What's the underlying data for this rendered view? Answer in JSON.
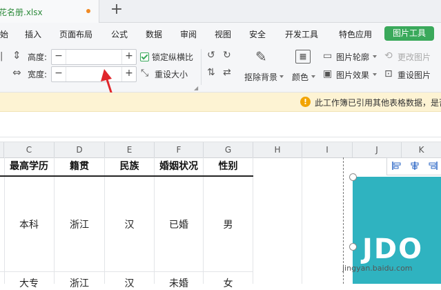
{
  "tabs": {
    "file_name": "花名册.xlsx",
    "add_tab": "+"
  },
  "menu": {
    "items": [
      "始",
      "插入",
      "页面布局",
      "公式",
      "数据",
      "审阅",
      "视图",
      "安全",
      "开发工具",
      "特色应用"
    ],
    "active": "图片工具"
  },
  "toolbar": {
    "height_label": "高度:",
    "width_label": "宽度:",
    "height_value": "",
    "width_value": "",
    "minus": "−",
    "plus": "+",
    "lock_ratio": "锁定纵横比",
    "lock_ratio_checked": true,
    "reset_size": "重设大小",
    "remove_bg": "抠除背景",
    "color": "颜色",
    "outline": "图片轮廓",
    "effects": "图片效果",
    "change_picture": "更改图片",
    "reset_picture": "重设图片"
  },
  "notice": {
    "icon": "!",
    "message": "此工作簿已引用其他表格数据，是否"
  },
  "grid": {
    "columns": [
      "C",
      "D",
      "E",
      "F",
      "G",
      "H",
      "I",
      "J",
      "K"
    ],
    "headers": [
      "最高学历",
      "籍贯",
      "民族",
      "婚姻状况",
      "性别"
    ],
    "rows": [
      [
        "本科",
        "浙江",
        "汉",
        "已婚",
        "男"
      ],
      [
        "大专",
        "浙江",
        "汉",
        "未婚",
        "女"
      ]
    ]
  },
  "picture": {
    "text": "JDO",
    "watermark": "jingyan.baidu.com"
  },
  "colors": {
    "accent": "#3aa95b",
    "picture_bg": "#2fb3c0",
    "notice_bg": "#fdf3d3",
    "arrow": "#e0262b"
  }
}
